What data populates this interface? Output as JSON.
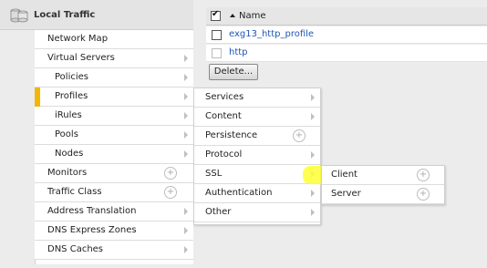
{
  "header": {
    "title": "Local Traffic",
    "icon": "database-icon"
  },
  "menu": {
    "items": [
      {
        "label": "Network Map",
        "sub": false,
        "arrow": false,
        "plus": false
      },
      {
        "label": "Virtual Servers",
        "sub": false,
        "arrow": true,
        "plus": false
      },
      {
        "label": "Policies",
        "sub": true,
        "arrow": true,
        "plus": false
      },
      {
        "label": "Profiles",
        "sub": true,
        "arrow": true,
        "plus": false,
        "active": true
      },
      {
        "label": "iRules",
        "sub": true,
        "arrow": true,
        "plus": false
      },
      {
        "label": "Pools",
        "sub": true,
        "arrow": true,
        "plus": false
      },
      {
        "label": "Nodes",
        "sub": true,
        "arrow": true,
        "plus": false
      },
      {
        "label": "Monitors",
        "sub": false,
        "arrow": false,
        "plus": true
      },
      {
        "label": "Traffic Class",
        "sub": false,
        "arrow": false,
        "plus": true
      },
      {
        "label": "Address Translation",
        "sub": false,
        "arrow": true,
        "plus": false
      },
      {
        "label": "DNS Express Zones",
        "sub": false,
        "arrow": true,
        "plus": false
      },
      {
        "label": "DNS Caches",
        "sub": false,
        "arrow": true,
        "plus": false
      }
    ]
  },
  "profile_list": {
    "column_header": "Name",
    "rows": [
      {
        "name": "exg13_http_profile",
        "checkbox_enabled": true
      },
      {
        "name": "http",
        "checkbox_enabled": false
      }
    ],
    "delete_label": "Delete..."
  },
  "profiles_flyout": {
    "items": [
      {
        "label": "Services",
        "arrow": true,
        "plus": false
      },
      {
        "label": "Content",
        "arrow": true,
        "plus": false
      },
      {
        "label": "Persistence",
        "arrow": false,
        "plus": true
      },
      {
        "label": "Protocol",
        "arrow": true,
        "plus": false
      },
      {
        "label": "SSL",
        "arrow": true,
        "plus": false,
        "highlighted": true
      },
      {
        "label": "Authentication",
        "arrow": true,
        "plus": false
      },
      {
        "label": "Other",
        "arrow": true,
        "plus": false
      }
    ]
  },
  "ssl_flyout": {
    "items": [
      {
        "label": "Client",
        "plus": true
      },
      {
        "label": "Server",
        "plus": true
      }
    ]
  },
  "colors": {
    "accent": "#f3b50a",
    "link": "#1f56b8",
    "highlight": "#ffff33"
  }
}
